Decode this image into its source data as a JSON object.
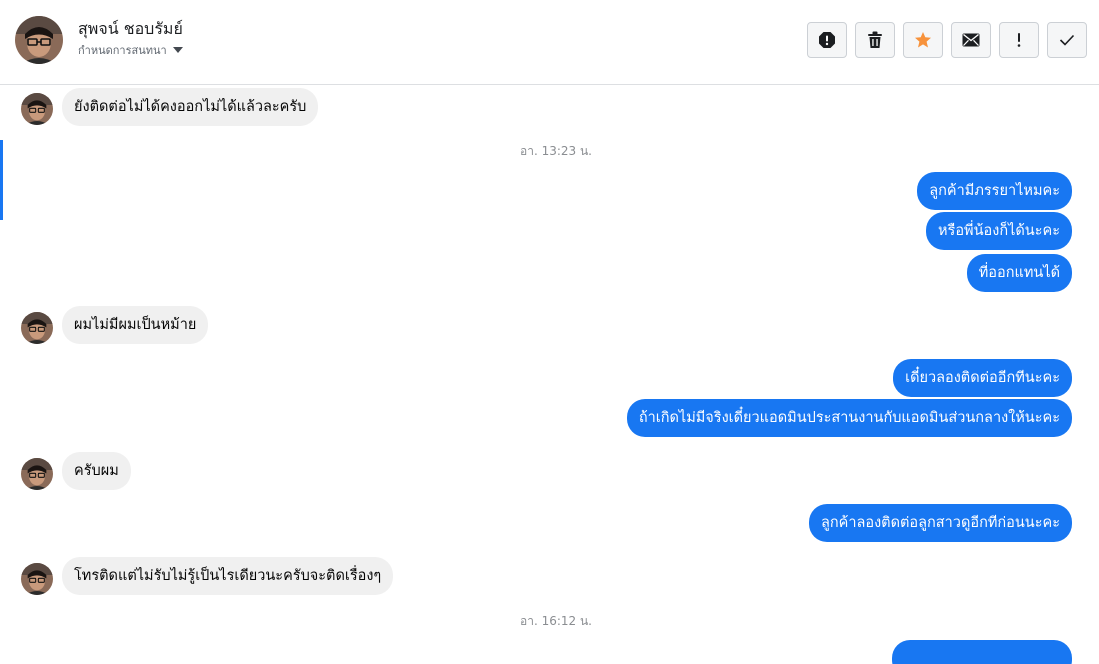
{
  "contact": {
    "name": "สุพจน์ ชอบรัมย์",
    "status": "กำหนดการสนทนา"
  },
  "toolbar": {
    "buttons": [
      {
        "icon": "spam-icon",
        "color": "#1c1e21"
      },
      {
        "icon": "trash-icon",
        "color": "#1c1e21"
      },
      {
        "icon": "star-icon",
        "color": "#f7923b"
      },
      {
        "icon": "envelope-icon",
        "color": "#1c1e21"
      },
      {
        "icon": "exclamation-icon",
        "color": "#1c1e21"
      },
      {
        "icon": "check-icon",
        "color": "#1c1e21"
      }
    ]
  },
  "colors": {
    "outgoing_bubble": "#1877f2",
    "incoming_bubble": "#f0f0f0",
    "accent": "#1877f2"
  },
  "messages": {
    "m1": "ยังติดต่อไม่ได้คงออกไม่ได้แล้วละครับ",
    "t1": "อา. 13:23 น.",
    "m2": "ลูกค้ามีภรรยาไหมคะ",
    "m3": "หรือพี่น้องก็ได้นะคะ",
    "m4": "ที่ออกแทนได้",
    "m5": "ผมไม่มีผมเป็นหม้าย",
    "m6": "เดี๋ยวลองติดต่ออีกทีนะคะ",
    "m7": "ถ้าเกิดไม่มีจริงเดี๋ยวแอดมินประสานงานกับแอดมินส่วนกลางให้นะคะ",
    "m8": "ครับผม",
    "m9": "ลูกค้าลองติดต่อลูกสาวดูอีกทีก่อนนะคะ",
    "m10": "โทรติดแต่ไม่รับไม่รู้เป็นไรเดียวนะครับจะติดเรื่องๆ",
    "t2": "อา. 16:12 น."
  }
}
